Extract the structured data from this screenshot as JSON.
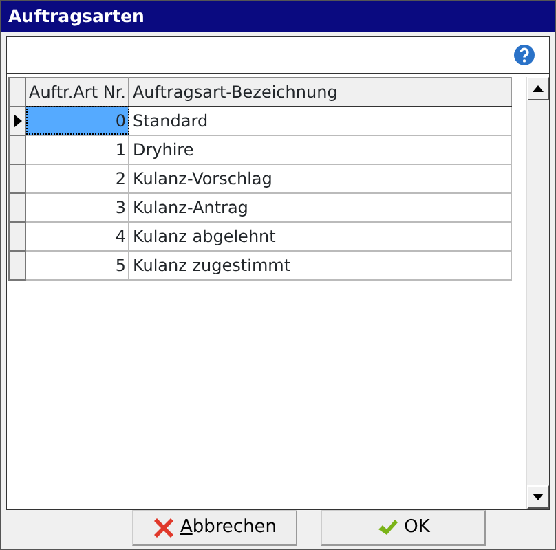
{
  "window": {
    "title": "Auftragsarten"
  },
  "table": {
    "columns": [
      "Auftr.Art Nr.",
      "Auftragsart-Bezeichnung"
    ],
    "rows": [
      {
        "number": "0",
        "name": "Standard",
        "selected": true
      },
      {
        "number": "1",
        "name": "Dryhire",
        "selected": false
      },
      {
        "number": "2",
        "name": "Kulanz-Vorschlag",
        "selected": false
      },
      {
        "number": "3",
        "name": "Kulanz-Antrag",
        "selected": false
      },
      {
        "number": "4",
        "name": "Kulanz abgelehnt",
        "selected": false
      },
      {
        "number": "5",
        "name": "Kulanz zugestimmt",
        "selected": false
      }
    ]
  },
  "buttons": [
    {
      "kind": "cancel",
      "label": "Abbrechen",
      "mnemonic_first": true
    },
    {
      "kind": "ok",
      "label": "OK",
      "mnemonic_first": false
    }
  ]
}
